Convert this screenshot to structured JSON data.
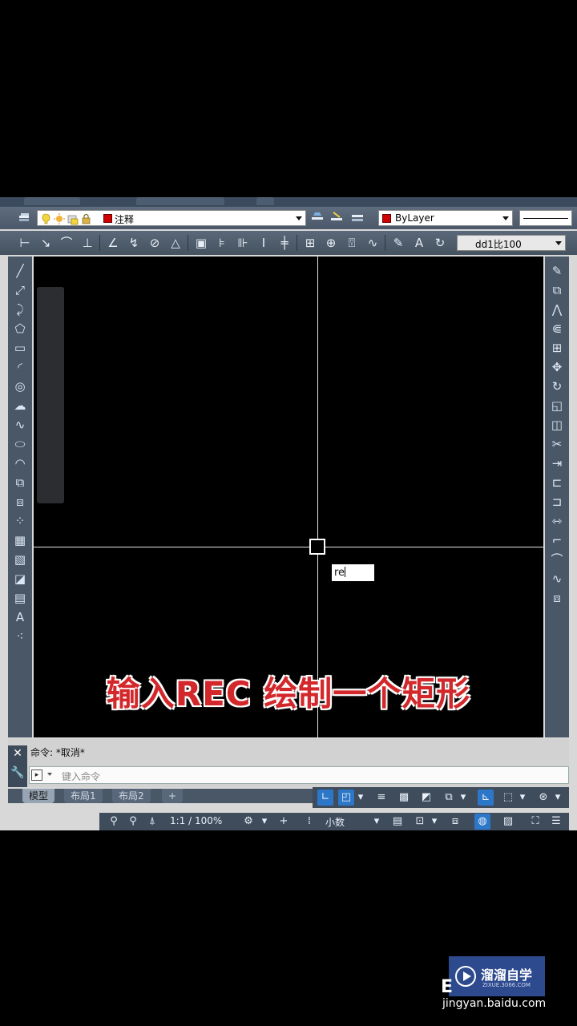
{
  "properties": {
    "layer_name": "注释",
    "color_value": "ByLayer",
    "layer_color": "#d00000",
    "dim_style": "dd1比100"
  },
  "canvas": {
    "dynamic_input": "re",
    "caption": "输入REC 绘制一个矩形",
    "caption_color": "#d3282b"
  },
  "command": {
    "history": "命令: *取消*",
    "placeholder": "键入命令"
  },
  "layout_tabs": [
    "模型",
    "布局1",
    "布局2"
  ],
  "status": {
    "scale": "1:1 / 100%",
    "units": "小数"
  },
  "watermark": {
    "brand": "溜溜自学",
    "domain": "ZIXUE.3066.COM",
    "footer": "jingyan.baidu.com",
    "footer_partial": "E"
  }
}
